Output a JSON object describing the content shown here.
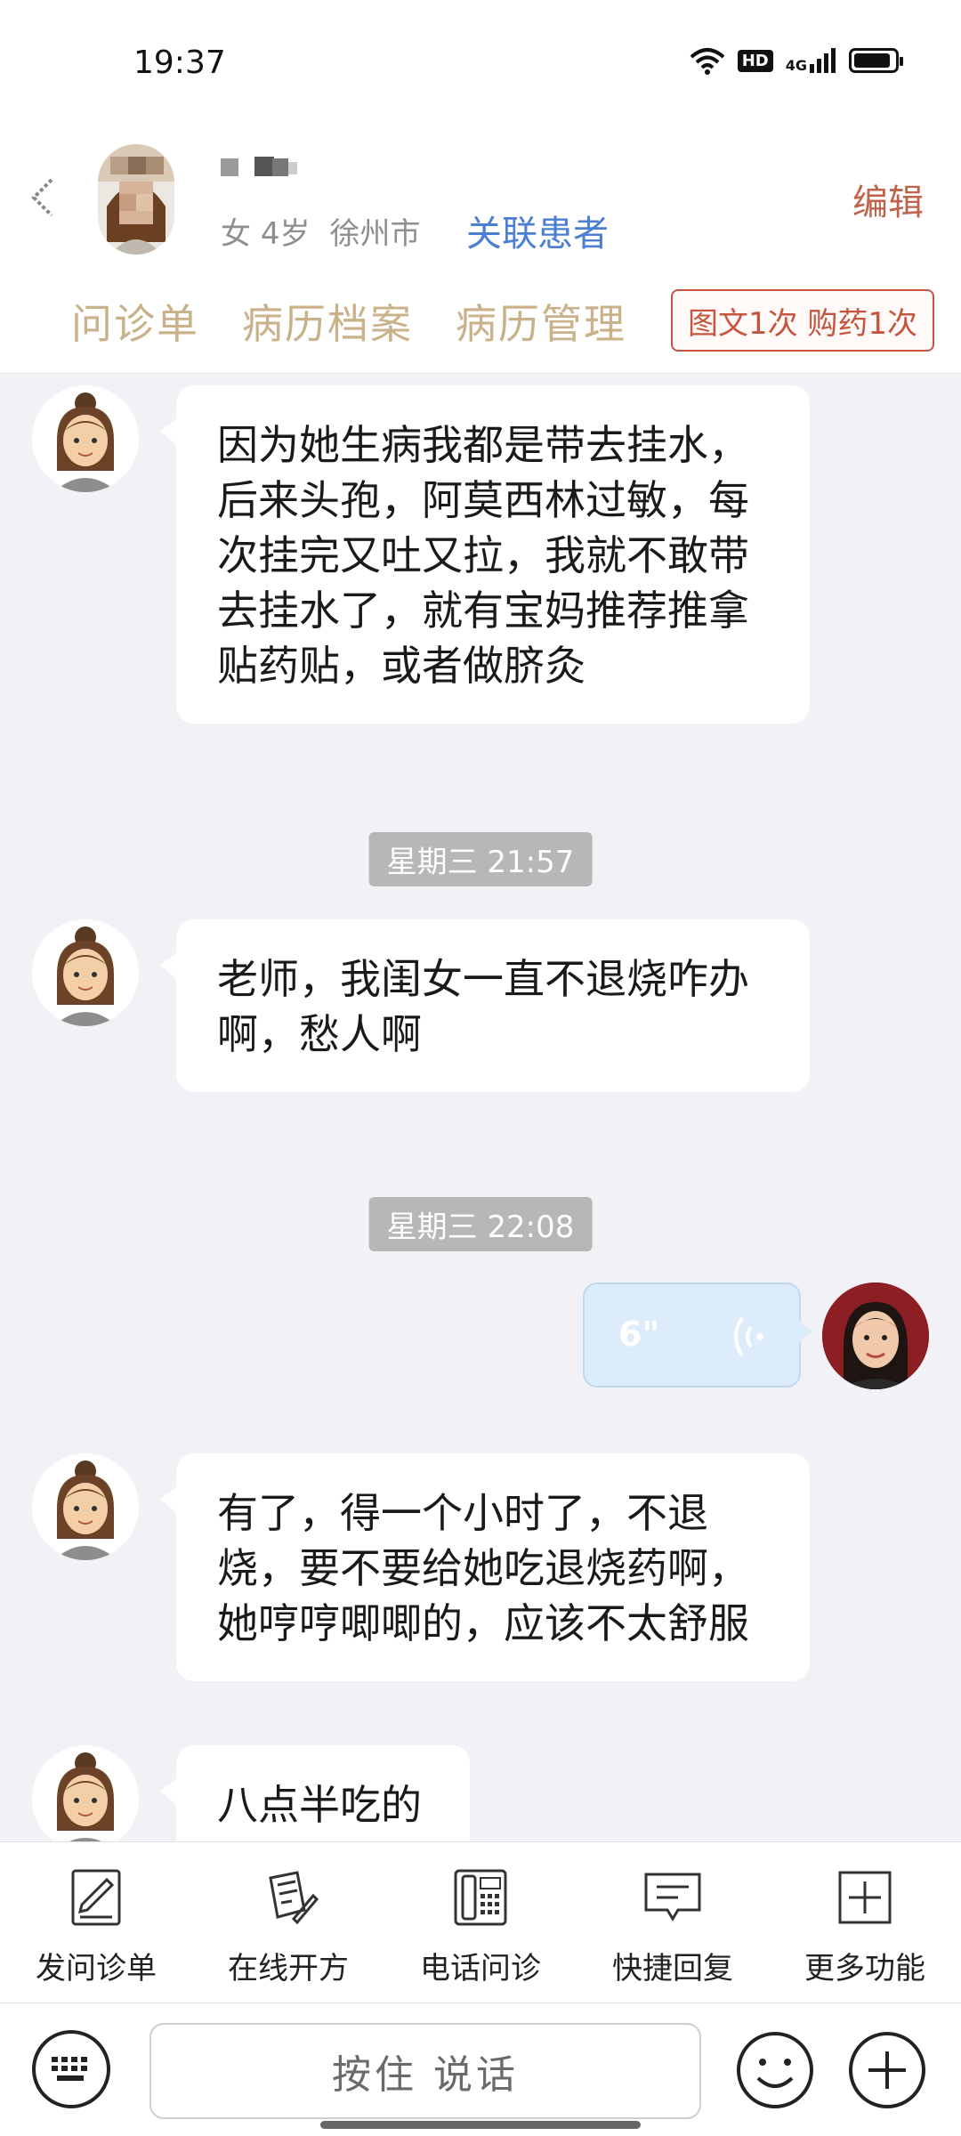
{
  "status_bar": {
    "time": "19:37",
    "hd": "HD",
    "network": "4G",
    "battery_level": 0.92
  },
  "header": {
    "gender": "女",
    "age": "4岁",
    "city": "徐州市",
    "link_patient": "关联患者",
    "edit": "编辑",
    "tabs": [
      "问诊单",
      "病历档案",
      "病历管理"
    ],
    "count_badge": "图文1次 购药1次"
  },
  "messages": {
    "m1": "因为她生病我都是带去挂水，后来头孢，阿莫西林过敏，每次挂完又吐又拉，我就不敢带去挂水了，就有宝妈推荐推拿贴药贴，或者做脐灸",
    "t1": "星期三 21:57",
    "m2": "老师，我闺女一直不退烧咋办啊，愁人啊",
    "t2": "星期三 22:08",
    "voice_duration": "6\"",
    "m3": "有了，得一个小时了，不退烧，要不要给她吃退烧药啊，她哼哼唧唧的，应该不太舒服",
    "m4": "八点半吃的"
  },
  "functions": [
    "发问诊单",
    "在线开方",
    "电话问诊",
    "快捷回复",
    "更多功能"
  ],
  "input": {
    "hold_to_talk": "按住 说话"
  },
  "colors": {
    "accent_red": "#c4553f",
    "link_blue": "#4c7fd4",
    "tab_tan": "#c9b18a",
    "chat_bg": "#f2f2f6"
  }
}
